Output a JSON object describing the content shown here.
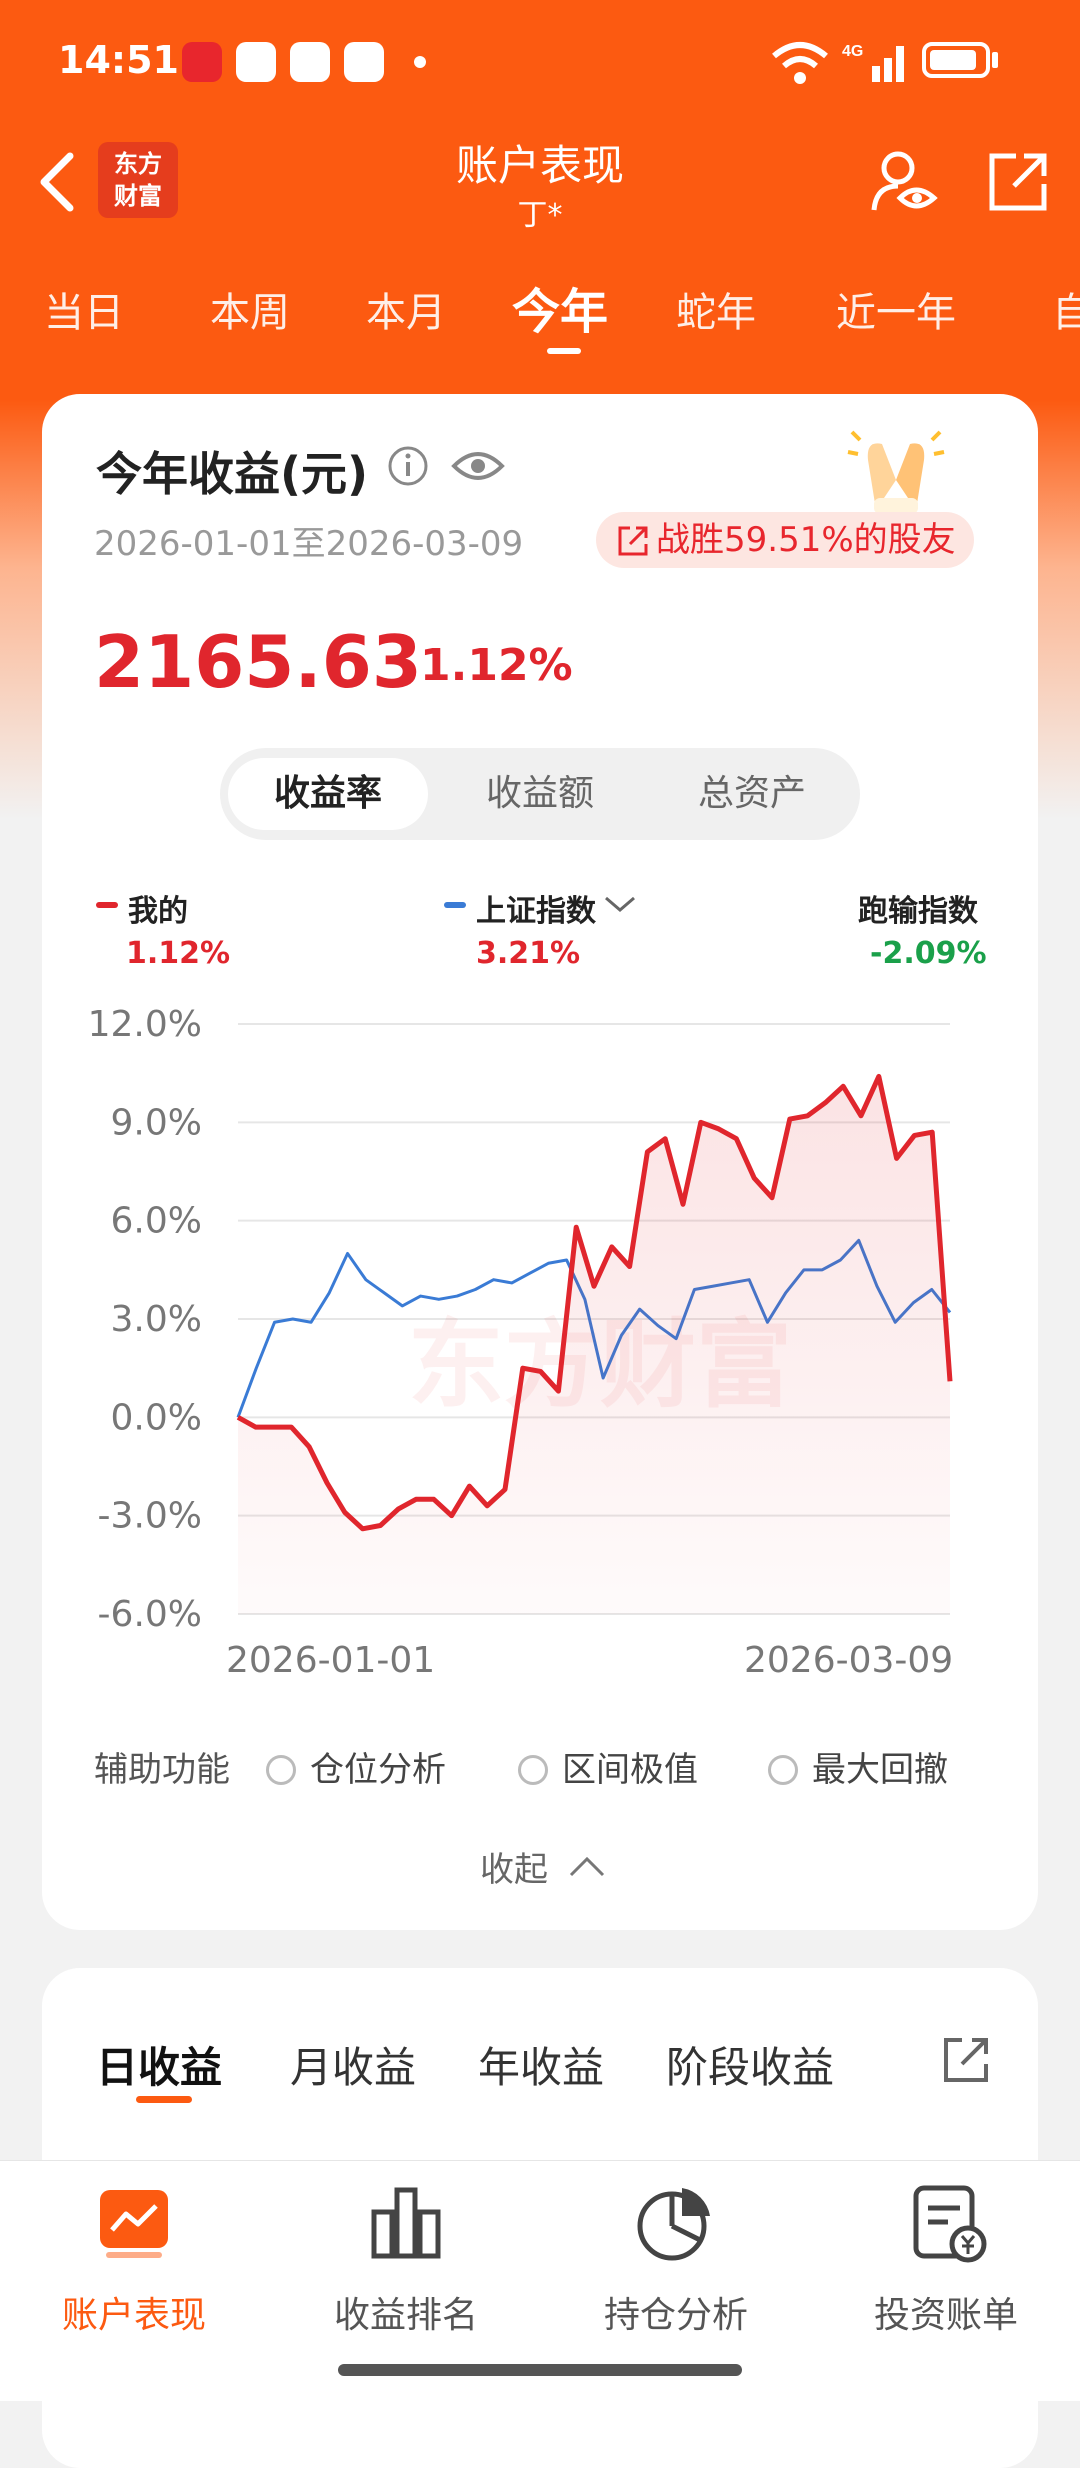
{
  "status_bar": {
    "time": "14:51",
    "network": "4G"
  },
  "header": {
    "logo_text": "东方\n财富",
    "title": "账户表现",
    "subtitle": "丁*"
  },
  "period_tabs": [
    "当日",
    "本周",
    "本月",
    "今年",
    "蛇年",
    "近一年",
    "自"
  ],
  "active_period": "今年",
  "summary": {
    "title": "今年收益(元)",
    "date_range": "2026-01-01至2026-03-09",
    "beat_text": "战胜59.51%的股友",
    "amount": "2165.63",
    "return_pct": "1.12%"
  },
  "segment": {
    "items": [
      "收益率",
      "收益额",
      "总资产"
    ],
    "active": "收益率"
  },
  "legend": {
    "mine_label": "我的",
    "mine_value": "1.12%",
    "index_label": "上证指数",
    "index_value": "3.21%",
    "diff_label": "跑输指数",
    "diff_value": "-2.09%"
  },
  "colors": {
    "brand": "#fc5a11",
    "mine": "#e0262d",
    "index": "#3a7bd5",
    "diff": "#1aa04a"
  },
  "chart_data": {
    "type": "line",
    "x_start_label": "2026-01-01",
    "x_end_label": "2026-03-09",
    "y_ticks": [
      "12.0%",
      "9.0%",
      "6.0%",
      "3.0%",
      "0.0%",
      "-3.0%",
      "-6.0%"
    ],
    "ylim": [
      -6,
      12
    ],
    "watermark": "东方财富",
    "series": [
      {
        "name": "我的",
        "values": [
          0.0,
          -0.3,
          -0.3,
          -0.3,
          -0.9,
          -2.0,
          -2.9,
          -3.4,
          -3.3,
          -2.8,
          -2.5,
          -2.5,
          -3.0,
          -2.1,
          -2.7,
          -2.2,
          1.5,
          1.4,
          0.8,
          5.8,
          4.0,
          5.2,
          4.6,
          8.1,
          8.5,
          6.5,
          9.0,
          8.8,
          8.5,
          7.3,
          6.7,
          9.1,
          9.2,
          9.6,
          10.1,
          9.2,
          10.4,
          7.9,
          8.6,
          8.7,
          1.1
        ]
      },
      {
        "name": "上证指数",
        "values": [
          0.0,
          1.5,
          2.9,
          3.0,
          2.9,
          3.8,
          5.0,
          4.2,
          3.8,
          3.4,
          3.7,
          3.6,
          3.7,
          3.9,
          4.2,
          4.1,
          4.4,
          4.7,
          4.8,
          3.6,
          1.2,
          2.5,
          3.3,
          2.8,
          2.4,
          3.9,
          4.0,
          4.1,
          4.2,
          2.9,
          3.8,
          4.5,
          4.5,
          4.8,
          5.4,
          4.0,
          2.9,
          3.5,
          3.9,
          3.2
        ]
      }
    ]
  },
  "aux": {
    "label": "辅助功能",
    "options": [
      "仓位分析",
      "区间极值",
      "最大回撤"
    ],
    "collapse": "收起"
  },
  "returns_tabs": [
    "日收益",
    "月收益",
    "年收益",
    "阶段收益"
  ],
  "bottom_nav": [
    "账户表现",
    "收益排名",
    "持仓分析",
    "投资账单"
  ]
}
